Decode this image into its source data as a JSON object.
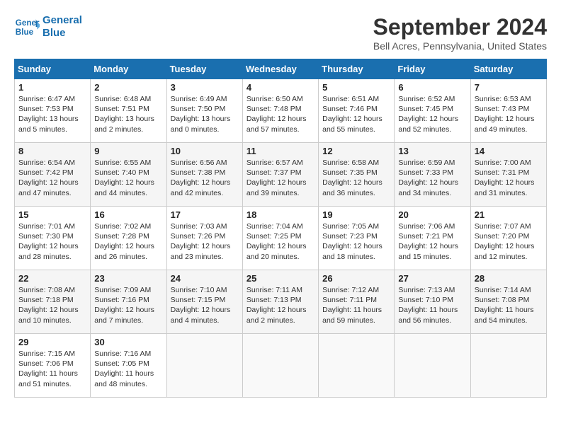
{
  "header": {
    "logo_line1": "General",
    "logo_line2": "Blue",
    "month_title": "September 2024",
    "location": "Bell Acres, Pennsylvania, United States"
  },
  "days_of_week": [
    "Sunday",
    "Monday",
    "Tuesday",
    "Wednesday",
    "Thursday",
    "Friday",
    "Saturday"
  ],
  "weeks": [
    [
      {
        "day": "1",
        "info": "Sunrise: 6:47 AM\nSunset: 7:53 PM\nDaylight: 13 hours\nand 5 minutes."
      },
      {
        "day": "2",
        "info": "Sunrise: 6:48 AM\nSunset: 7:51 PM\nDaylight: 13 hours\nand 2 minutes."
      },
      {
        "day": "3",
        "info": "Sunrise: 6:49 AM\nSunset: 7:50 PM\nDaylight: 13 hours\nand 0 minutes."
      },
      {
        "day": "4",
        "info": "Sunrise: 6:50 AM\nSunset: 7:48 PM\nDaylight: 12 hours\nand 57 minutes."
      },
      {
        "day": "5",
        "info": "Sunrise: 6:51 AM\nSunset: 7:46 PM\nDaylight: 12 hours\nand 55 minutes."
      },
      {
        "day": "6",
        "info": "Sunrise: 6:52 AM\nSunset: 7:45 PM\nDaylight: 12 hours\nand 52 minutes."
      },
      {
        "day": "7",
        "info": "Sunrise: 6:53 AM\nSunset: 7:43 PM\nDaylight: 12 hours\nand 49 minutes."
      }
    ],
    [
      {
        "day": "8",
        "info": "Sunrise: 6:54 AM\nSunset: 7:42 PM\nDaylight: 12 hours\nand 47 minutes."
      },
      {
        "day": "9",
        "info": "Sunrise: 6:55 AM\nSunset: 7:40 PM\nDaylight: 12 hours\nand 44 minutes."
      },
      {
        "day": "10",
        "info": "Sunrise: 6:56 AM\nSunset: 7:38 PM\nDaylight: 12 hours\nand 42 minutes."
      },
      {
        "day": "11",
        "info": "Sunrise: 6:57 AM\nSunset: 7:37 PM\nDaylight: 12 hours\nand 39 minutes."
      },
      {
        "day": "12",
        "info": "Sunrise: 6:58 AM\nSunset: 7:35 PM\nDaylight: 12 hours\nand 36 minutes."
      },
      {
        "day": "13",
        "info": "Sunrise: 6:59 AM\nSunset: 7:33 PM\nDaylight: 12 hours\nand 34 minutes."
      },
      {
        "day": "14",
        "info": "Sunrise: 7:00 AM\nSunset: 7:31 PM\nDaylight: 12 hours\nand 31 minutes."
      }
    ],
    [
      {
        "day": "15",
        "info": "Sunrise: 7:01 AM\nSunset: 7:30 PM\nDaylight: 12 hours\nand 28 minutes."
      },
      {
        "day": "16",
        "info": "Sunrise: 7:02 AM\nSunset: 7:28 PM\nDaylight: 12 hours\nand 26 minutes."
      },
      {
        "day": "17",
        "info": "Sunrise: 7:03 AM\nSunset: 7:26 PM\nDaylight: 12 hours\nand 23 minutes."
      },
      {
        "day": "18",
        "info": "Sunrise: 7:04 AM\nSunset: 7:25 PM\nDaylight: 12 hours\nand 20 minutes."
      },
      {
        "day": "19",
        "info": "Sunrise: 7:05 AM\nSunset: 7:23 PM\nDaylight: 12 hours\nand 18 minutes."
      },
      {
        "day": "20",
        "info": "Sunrise: 7:06 AM\nSunset: 7:21 PM\nDaylight: 12 hours\nand 15 minutes."
      },
      {
        "day": "21",
        "info": "Sunrise: 7:07 AM\nSunset: 7:20 PM\nDaylight: 12 hours\nand 12 minutes."
      }
    ],
    [
      {
        "day": "22",
        "info": "Sunrise: 7:08 AM\nSunset: 7:18 PM\nDaylight: 12 hours\nand 10 minutes."
      },
      {
        "day": "23",
        "info": "Sunrise: 7:09 AM\nSunset: 7:16 PM\nDaylight: 12 hours\nand 7 minutes."
      },
      {
        "day": "24",
        "info": "Sunrise: 7:10 AM\nSunset: 7:15 PM\nDaylight: 12 hours\nand 4 minutes."
      },
      {
        "day": "25",
        "info": "Sunrise: 7:11 AM\nSunset: 7:13 PM\nDaylight: 12 hours\nand 2 minutes."
      },
      {
        "day": "26",
        "info": "Sunrise: 7:12 AM\nSunset: 7:11 PM\nDaylight: 11 hours\nand 59 minutes."
      },
      {
        "day": "27",
        "info": "Sunrise: 7:13 AM\nSunset: 7:10 PM\nDaylight: 11 hours\nand 56 minutes."
      },
      {
        "day": "28",
        "info": "Sunrise: 7:14 AM\nSunset: 7:08 PM\nDaylight: 11 hours\nand 54 minutes."
      }
    ],
    [
      {
        "day": "29",
        "info": "Sunrise: 7:15 AM\nSunset: 7:06 PM\nDaylight: 11 hours\nand 51 minutes."
      },
      {
        "day": "30",
        "info": "Sunrise: 7:16 AM\nSunset: 7:05 PM\nDaylight: 11 hours\nand 48 minutes."
      },
      {
        "day": "",
        "info": ""
      },
      {
        "day": "",
        "info": ""
      },
      {
        "day": "",
        "info": ""
      },
      {
        "day": "",
        "info": ""
      },
      {
        "day": "",
        "info": ""
      }
    ]
  ]
}
